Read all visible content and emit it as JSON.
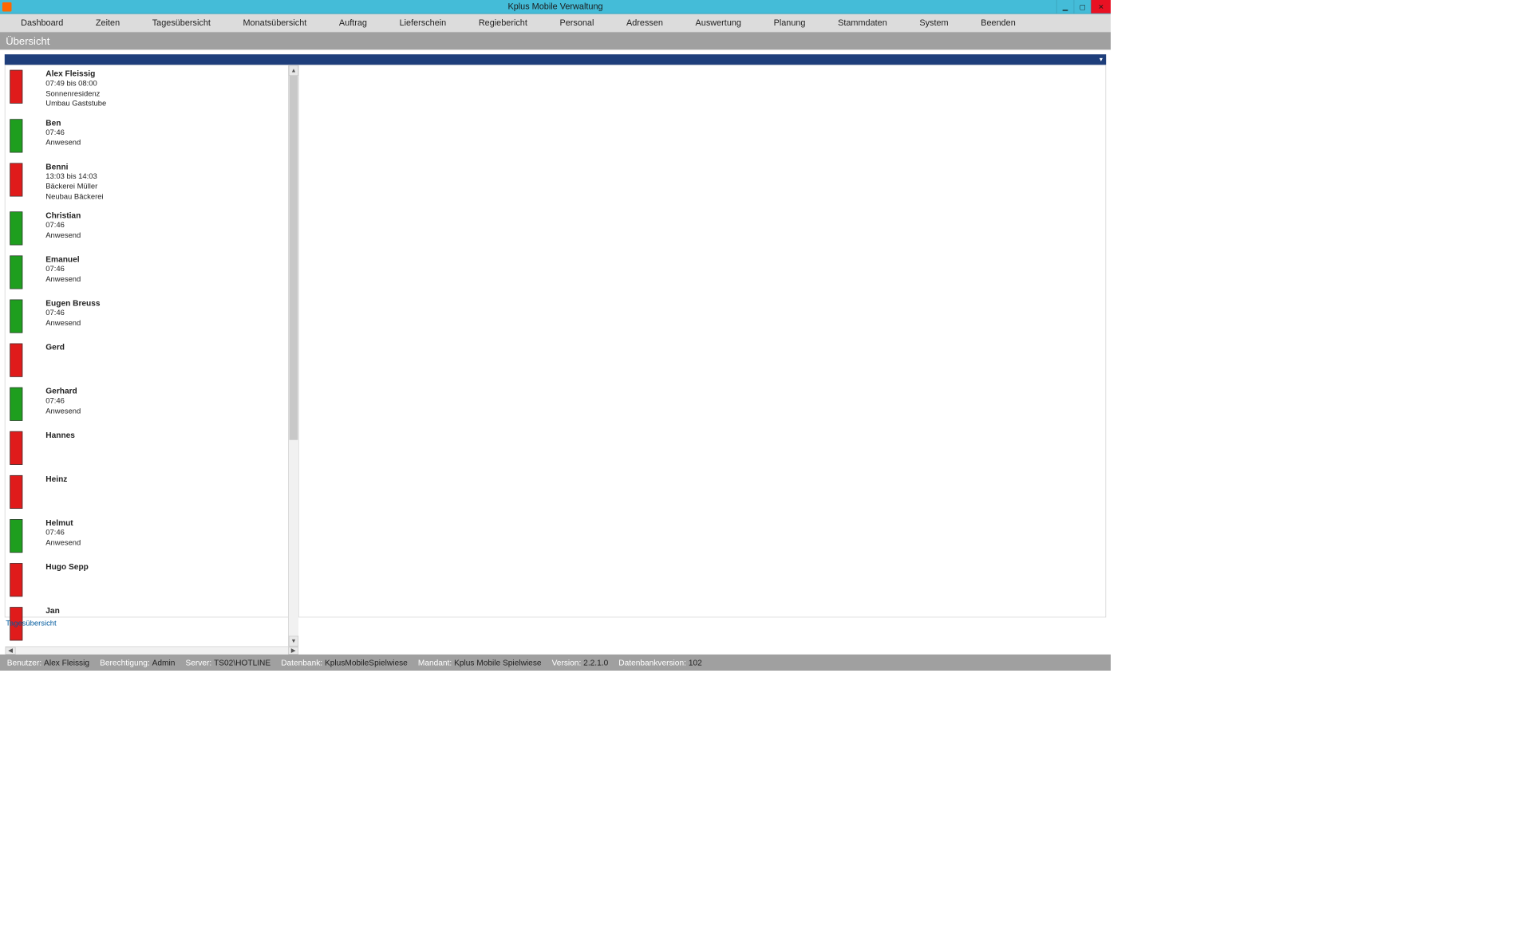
{
  "window": {
    "title": "Kplus Mobile Verwaltung"
  },
  "menu": {
    "items": [
      "Dashboard",
      "Zeiten",
      "Tagesübersicht",
      "Monatsübersicht",
      "Auftrag",
      "Lieferschein",
      "Regiebericht",
      "Personal",
      "Adressen",
      "Auswertung",
      "Planung",
      "Stammdaten",
      "System",
      "Beenden"
    ]
  },
  "section": {
    "title": "Übersicht"
  },
  "list": {
    "entries": [
      {
        "status": "red",
        "name": "Alex Fleissig",
        "line1": "07:49 bis 08:00",
        "line2": "Sonnenresidenz",
        "line3": "Umbau Gaststube"
      },
      {
        "status": "green",
        "name": "Ben",
        "line1": "07:46",
        "line2": "Anwesend",
        "line3": ""
      },
      {
        "status": "red",
        "name": "Benni",
        "line1": "13:03 bis 14:03",
        "line2": "Bäckerei Müller",
        "line3": "Neubau Bäckerei"
      },
      {
        "status": "green",
        "name": "Christian",
        "line1": "07:46",
        "line2": "Anwesend",
        "line3": ""
      },
      {
        "status": "green",
        "name": "Emanuel",
        "line1": "07:46",
        "line2": "Anwesend",
        "line3": ""
      },
      {
        "status": "green",
        "name": "Eugen Breuss",
        "line1": "07:46",
        "line2": "Anwesend",
        "line3": ""
      },
      {
        "status": "red",
        "name": "Gerd",
        "line1": "",
        "line2": "",
        "line3": ""
      },
      {
        "status": "green",
        "name": "Gerhard",
        "line1": "07:46",
        "line2": "Anwesend",
        "line3": ""
      },
      {
        "status": "red",
        "name": "Hannes",
        "line1": "",
        "line2": "",
        "line3": ""
      },
      {
        "status": "red",
        "name": "Heinz",
        "line1": "",
        "line2": "",
        "line3": ""
      },
      {
        "status": "green",
        "name": "Helmut",
        "line1": "07:46",
        "line2": "Anwesend",
        "line3": ""
      },
      {
        "status": "red",
        "name": "Hugo Sepp",
        "line1": "",
        "line2": "",
        "line3": ""
      },
      {
        "status": "red",
        "name": "Jan",
        "line1": "",
        "line2": "",
        "line3": ""
      }
    ]
  },
  "footer": {
    "link": "Tagesübersicht"
  },
  "status": {
    "labels": {
      "user": "Benutzer:",
      "perm": "Berechtigung:",
      "server": "Server:",
      "db": "Datenbank:",
      "mandant": "Mandant:",
      "version": "Version:",
      "dbver": "Datenbankversion:"
    },
    "values": {
      "user": "Alex Fleissig",
      "perm": "Admin",
      "server": "TS02\\HOTLINE",
      "db": "KplusMobileSpielwiese",
      "mandant": "Kplus Mobile Spielwiese",
      "version": "2.2.1.0",
      "dbver": "102"
    }
  }
}
